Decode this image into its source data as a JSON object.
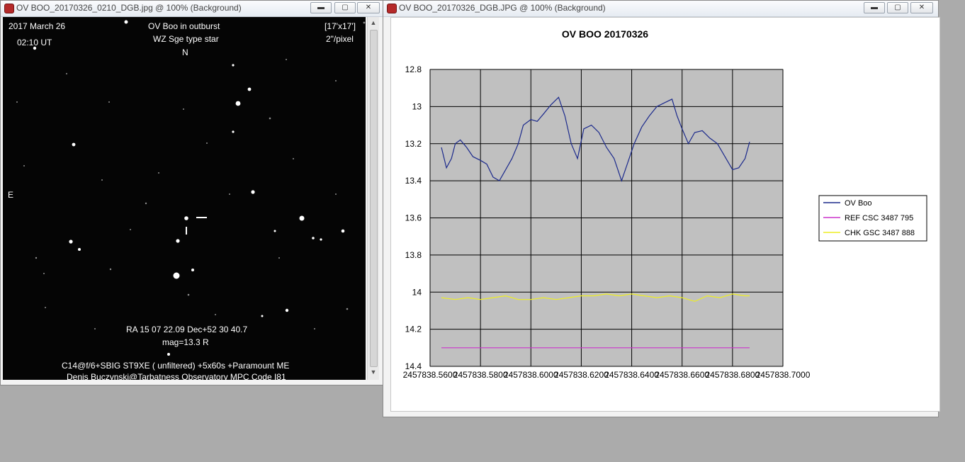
{
  "image_window": {
    "title": "OV BOO_20170326_0210_DGB.jpg @ 100% (Background)",
    "overlay": {
      "date": "2017 March 26",
      "time": "02:10 UT",
      "headline": "OV Boo in outburst",
      "subtitle": "WZ Sge type star",
      "north": "N",
      "east": "E",
      "fov": "[17'x17']",
      "scale": "2\"/pixel",
      "coords": "RA 15 07 22.09 Dec+52 30 40.7",
      "mag": "mag=13.3 R",
      "equipment": "C14@f/6+SBIG ST9XE ( unfiltered)  +5x60s +Paramount ME",
      "credit": "Denis Buczynski@Tarbatness Observatory MPC Code I81"
    }
  },
  "chart_window": {
    "title": "OV BOO_20170326_DGB.JPG @ 100% (Background)"
  },
  "window_buttons": {
    "minimize": "▬",
    "maximize": "▢",
    "close": "✕"
  },
  "icons": {
    "title": "app-icon",
    "scroll_up": "▲",
    "scroll_down": "▼"
  },
  "chart_data": {
    "type": "line",
    "title": "OV BOO 20170326",
    "y_ticks": [
      "12.8",
      "13",
      "13.2",
      "13.4",
      "13.6",
      "13.8",
      "14",
      "14.2",
      "14.4"
    ],
    "x_ticks": [
      "2457838.5600",
      "2457838.5800",
      "2457838.6000",
      "2457838.6200",
      "2457838.6400",
      "2457838.6600",
      "2457838.6800",
      "2457838.7000"
    ],
    "ylim": [
      12.8,
      14.4
    ],
    "y_inverted": false,
    "xlim": [
      2457838.56,
      2457838.7
    ],
    "grid": true,
    "legend_position": "right",
    "plot_background": "#c0c0c0",
    "series": [
      {
        "name": "OV Boo",
        "color": "#1c2a8c",
        "x": [
          2457838.5645,
          2457838.5665,
          2457838.5685,
          2457838.57,
          2457838.572,
          2457838.5745,
          2457838.577,
          2457838.58,
          2457838.5825,
          2457838.585,
          2457838.5875,
          2457838.59,
          2457838.5925,
          2457838.595,
          2457838.597,
          2457838.6,
          2457838.6025,
          2457838.605,
          2457838.608,
          2457838.611,
          2457838.6135,
          2457838.616,
          2457838.6185,
          2457838.621,
          2457838.624,
          2457838.627,
          2457838.63,
          2457838.633,
          2457838.636,
          2457838.6385,
          2457838.641,
          2457838.644,
          2457838.647,
          2457838.65,
          2457838.653,
          2457838.656,
          2457838.658,
          2457838.66,
          2457838.6625,
          2457838.665,
          2457838.668,
          2457838.671,
          2457838.674,
          2457838.677,
          2457838.68,
          2457838.6825,
          2457838.685,
          2457838.6868
        ],
        "values": [
          13.22,
          13.33,
          13.28,
          13.2,
          13.18,
          13.22,
          13.27,
          13.29,
          13.31,
          13.38,
          13.4,
          13.34,
          13.28,
          13.2,
          13.1,
          13.07,
          13.08,
          13.04,
          12.99,
          12.95,
          13.05,
          13.2,
          13.28,
          13.12,
          13.1,
          13.14,
          13.22,
          13.28,
          13.4,
          13.3,
          13.2,
          13.11,
          13.05,
          13.0,
          12.98,
          12.96,
          13.05,
          13.12,
          13.2,
          13.14,
          13.13,
          13.17,
          13.2,
          13.27,
          13.34,
          13.33,
          13.28,
          13.19
        ]
      },
      {
        "name": "REF CSC 3487 795",
        "color": "#cc33cc",
        "x": [
          2457838.5645,
          2457838.6868
        ],
        "values": [
          14.3,
          14.3
        ]
      },
      {
        "name": "CHK GSC 3487 888",
        "color": "#eeee22",
        "x": [
          2457838.5645,
          2457838.57,
          2457838.575,
          2457838.58,
          2457838.585,
          2457838.59,
          2457838.595,
          2457838.6,
          2457838.605,
          2457838.61,
          2457838.615,
          2457838.62,
          2457838.625,
          2457838.63,
          2457838.635,
          2457838.64,
          2457838.645,
          2457838.65,
          2457838.655,
          2457838.66,
          2457838.665,
          2457838.67,
          2457838.675,
          2457838.68,
          2457838.685,
          2457838.6868
        ],
        "values": [
          14.03,
          14.04,
          14.03,
          14.04,
          14.03,
          14.02,
          14.04,
          14.04,
          14.03,
          14.04,
          14.03,
          14.02,
          14.02,
          14.01,
          14.02,
          14.01,
          14.02,
          14.03,
          14.02,
          14.03,
          14.05,
          14.02,
          14.03,
          14.01,
          14.02,
          14.02
        ]
      }
    ]
  }
}
